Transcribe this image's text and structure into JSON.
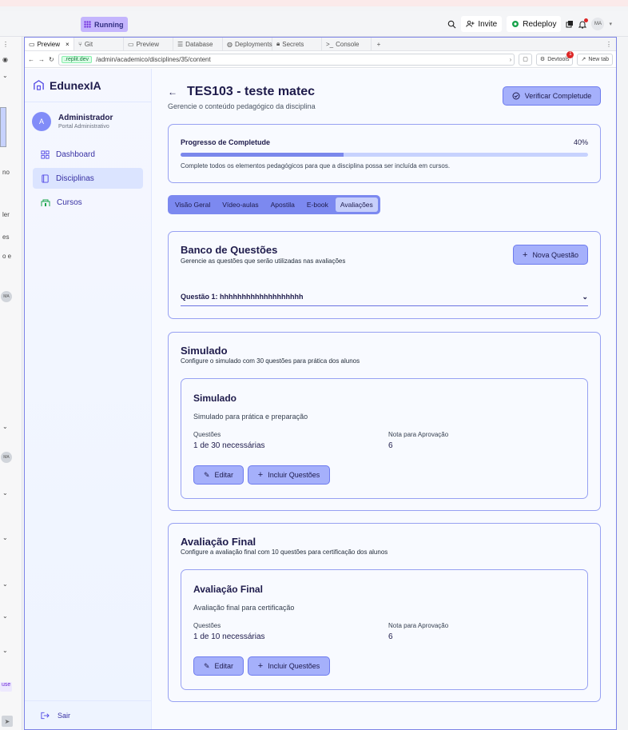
{
  "ide": {
    "status": "Running",
    "invite": "Invite",
    "redeploy": "Redeploy",
    "avatar": "MA"
  },
  "left_strip": {
    "snippets": [
      "no",
      "ler",
      "es",
      "o e"
    ],
    "badge": "MA",
    "bottom_tag": "use"
  },
  "browser": {
    "tabs": [
      "Preview",
      "Git",
      "Preview",
      "Database",
      "Deployments",
      "Secrets",
      "Console"
    ],
    "url_host": ".replit.dev",
    "url_path": "/admin/academico/disciplines/35/content",
    "devtools": "Devtools",
    "devtools_badge": "1",
    "new_tab": "New tab"
  },
  "sidebar": {
    "brand": "EdunexIA",
    "user_initial": "A",
    "user_name": "Administrador",
    "user_role": "Portal Administrativo",
    "items": [
      {
        "label": "Dashboard"
      },
      {
        "label": "Disciplinas"
      },
      {
        "label": "Cursos"
      }
    ],
    "logout": "Sair"
  },
  "page": {
    "title": "TES103 - teste matec",
    "subtitle": "Gerencie o conteúdo pedagógico da disciplina",
    "verify_button": "Verificar Completude"
  },
  "progress": {
    "label": "Progresso de Completude",
    "value_text": "40%",
    "value": 0.4,
    "note": "Complete todos os elementos pedagógicos para que a disciplina possa ser incluída em cursos."
  },
  "content_tabs": [
    "Visão Geral",
    "Vídeo-aulas",
    "Apostila",
    "E-book",
    "Avaliações"
  ],
  "banco": {
    "title": "Banco de Questões",
    "subtitle": "Gerencie as questões que serão utilizadas nas avaliações",
    "new_button": "Nova Questão",
    "question": "Questão 1: hhhhhhhhhhhhhhhhhhh"
  },
  "simulado": {
    "title": "Simulado",
    "subtitle": "Configure o simulado com 30 questões para prática dos alunos",
    "inner_title": "Simulado",
    "inner_sub": "Simulado para prática e preparação",
    "questions_label": "Questões",
    "questions_value": "1 de 30 necessárias",
    "grade_label": "Nota para Aprovação",
    "grade_value": "6",
    "edit": "Editar",
    "include": "Incluir Questões"
  },
  "final": {
    "title": "Avaliação Final",
    "subtitle": "Configure a avaliação final com 10 questões para certificação dos alunos",
    "inner_title": "Avaliação Final",
    "inner_sub": "Avaliação final para certificação",
    "questions_label": "Questões",
    "questions_value": "1 de 10 necessárias",
    "grade_label": "Nota para Aprovação",
    "grade_value": "6",
    "edit": "Editar",
    "include": "Incluir Questões"
  },
  "colors": {
    "accent": "#7c89f0",
    "button": "#a5b0fb",
    "border": "#97a1f2"
  }
}
